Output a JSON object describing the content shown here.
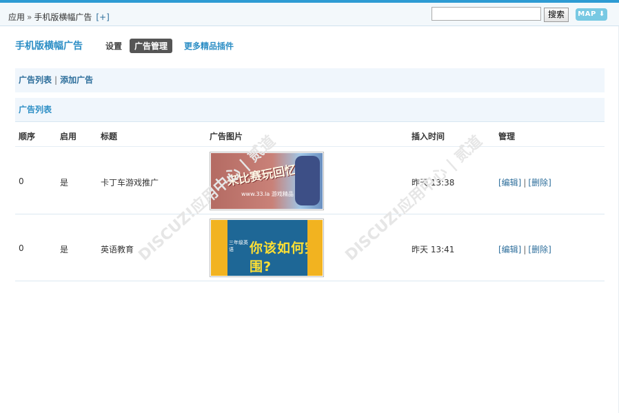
{
  "topbar": {
    "breadcrumb": {
      "root": "应用",
      "sep": "»",
      "current": "手机版横幅广告",
      "add": "[+]"
    },
    "search": {
      "value": "",
      "button": "搜索"
    },
    "map_label": "MAP"
  },
  "header": {
    "title": "手机版横幅广告",
    "tabs": [
      "设置",
      "广告管理",
      "更多精品插件"
    ],
    "active_tab": "广告管理"
  },
  "subnav": {
    "list": "广告列表",
    "add": "添加广告"
  },
  "section_title": "广告列表",
  "table": {
    "columns": [
      "顺序",
      "启用",
      "标题",
      "广告图片",
      "插入时间",
      "管理"
    ],
    "rows": [
      {
        "order": "0",
        "enabled": "是",
        "title": "卡丁车游戏推广",
        "time": "昨天 13:38",
        "edit": "[编辑]",
        "delete": "[删除]",
        "image_text": "来比赛玩回忆吧!",
        "image_sub": "www.33.la 游戏精品"
      },
      {
        "order": "0",
        "enabled": "是",
        "title": "英语教育",
        "time": "昨天 13:41",
        "edit": "[编辑]",
        "delete": "[删除]",
        "image_text": "你该如何突围?",
        "image_sub": "三年级英语"
      }
    ]
  },
  "watermark": "DISCUZ!应用中心 | 贰道",
  "colors": {
    "accent": "#2c8ec5",
    "link": "#2d6e9b",
    "active_tab_bg": "#555555",
    "panel_bg": "#f0f6fc"
  }
}
